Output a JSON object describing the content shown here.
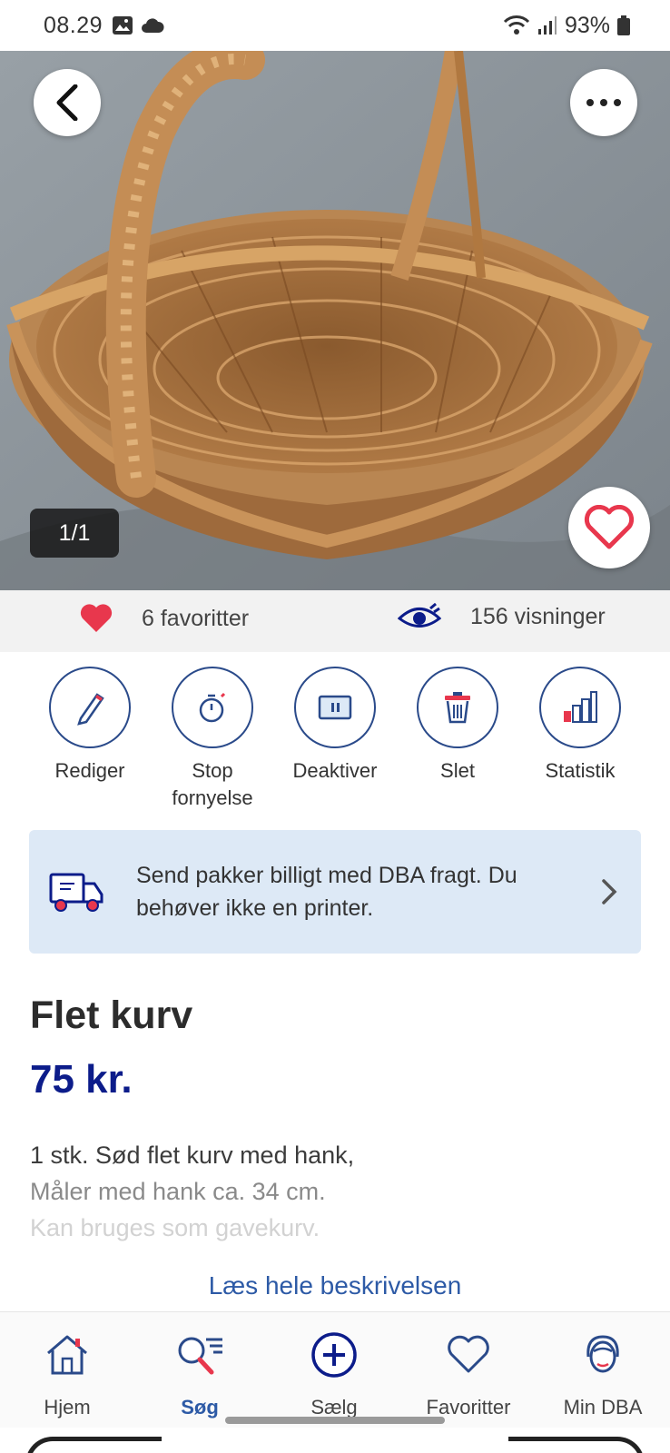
{
  "status_bar": {
    "time": "08.29",
    "battery": "93%"
  },
  "gallery": {
    "counter": "1/1"
  },
  "stats": {
    "favorites": "6 favoritter",
    "views": "156 visninger"
  },
  "actions": [
    {
      "label": "Rediger",
      "icon": "pencil-icon"
    },
    {
      "label": "Stop fornyelse",
      "icon": "stopwatch-icon"
    },
    {
      "label": "Deaktiver",
      "icon": "pause-icon"
    },
    {
      "label": "Slet",
      "icon": "trash-icon"
    },
    {
      "label": "Statistik",
      "icon": "bar-chart-icon"
    }
  ],
  "shipping_banner": {
    "text": "Send pakker billigt med DBA fragt. Du behøver ikke en printer."
  },
  "listing": {
    "title": "Flet kurv",
    "price": "75 kr.",
    "description_lines": [
      "1 stk. Sød flet kurv med hank,",
      "Måler med hank ca. 34 cm.",
      "Kan bruges som gavekurv."
    ],
    "read_more": "Læs hele beskrivelsen"
  },
  "bottom_nav": [
    {
      "label": "Hjem",
      "icon": "home-icon",
      "active": false
    },
    {
      "label": "Søg",
      "icon": "search-icon",
      "active": true
    },
    {
      "label": "Sælg",
      "icon": "plus-circle-icon",
      "active": false
    },
    {
      "label": "Favoritter",
      "icon": "heart-icon",
      "active": false
    },
    {
      "label": "Min DBA",
      "icon": "profile-icon",
      "active": false
    }
  ],
  "colors": {
    "brand_blue": "#0c1c8a",
    "link_blue": "#2d5aa6",
    "heart_red": "#e8374d",
    "banner_bg": "#dde9f6"
  }
}
